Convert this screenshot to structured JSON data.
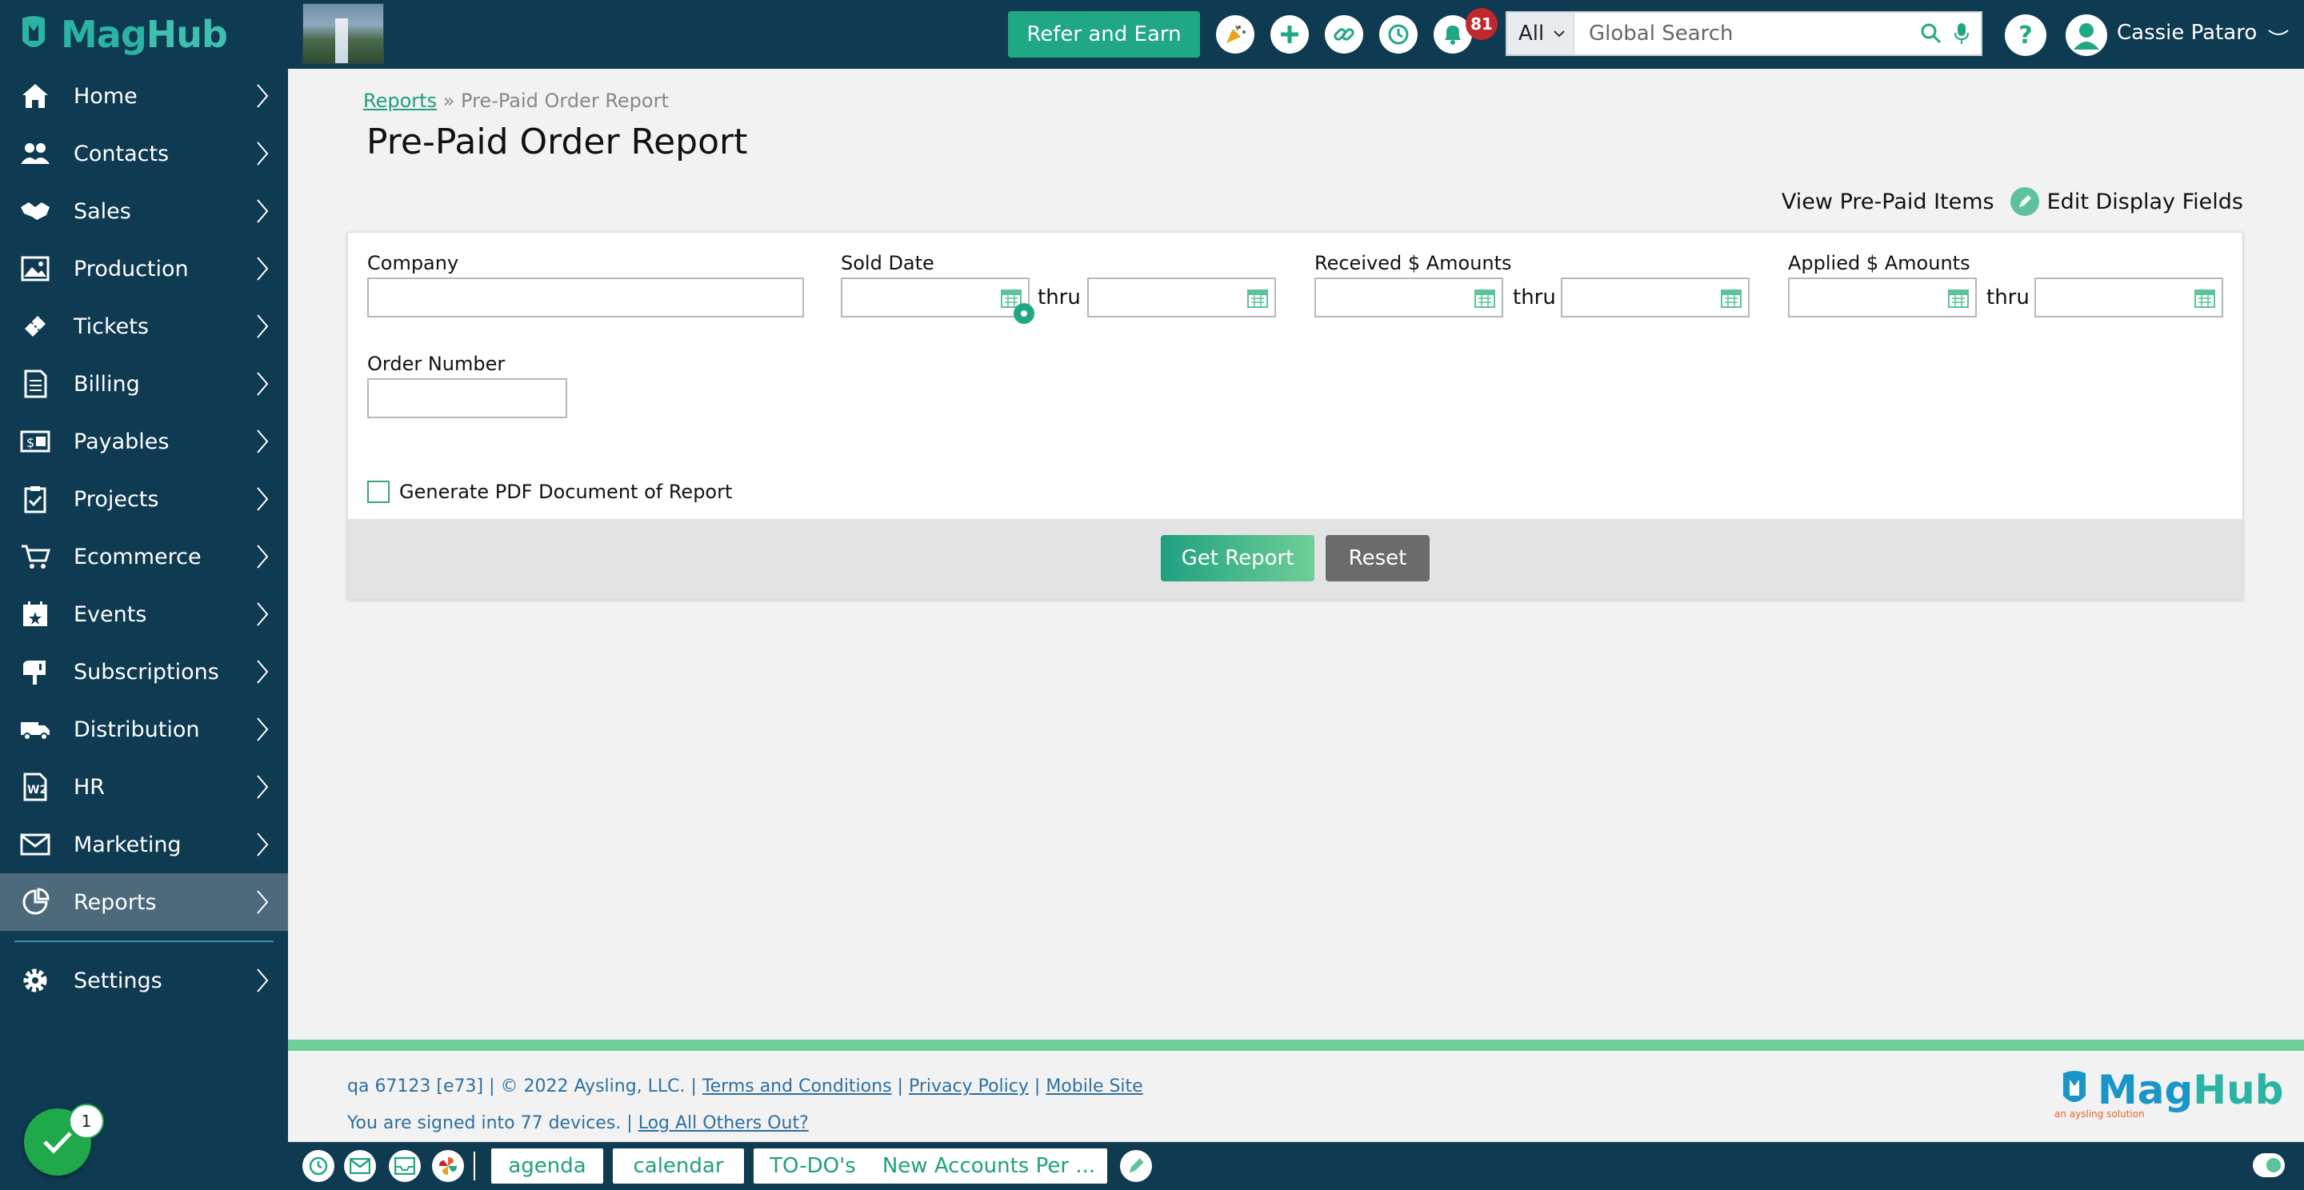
{
  "brand": {
    "name_part1": "Mag",
    "name_part2": "Hub"
  },
  "sidebar": {
    "items": [
      {
        "label": "Home",
        "icon": "home-icon"
      },
      {
        "label": "Contacts",
        "icon": "contacts-icon"
      },
      {
        "label": "Sales",
        "icon": "handshake-icon"
      },
      {
        "label": "Production",
        "icon": "image-icon"
      },
      {
        "label": "Tickets",
        "icon": "ticket-icon"
      },
      {
        "label": "Billing",
        "icon": "invoice-icon"
      },
      {
        "label": "Payables",
        "icon": "payables-icon"
      },
      {
        "label": "Projects",
        "icon": "clipboard-icon"
      },
      {
        "label": "Ecommerce",
        "icon": "cart-icon"
      },
      {
        "label": "Events",
        "icon": "calendar-star-icon"
      },
      {
        "label": "Subscriptions",
        "icon": "mailbox-icon"
      },
      {
        "label": "Distribution",
        "icon": "truck-icon"
      },
      {
        "label": "HR",
        "icon": "w2-icon"
      },
      {
        "label": "Marketing",
        "icon": "envelope-icon"
      },
      {
        "label": "Reports",
        "icon": "reports-icon"
      }
    ],
    "settings": {
      "label": "Settings",
      "icon": "gear-icon"
    },
    "active_index": 14,
    "task_count": "1"
  },
  "topbar": {
    "refer_label": "Refer and Earn",
    "notifications_count": "81",
    "search": {
      "scope": "All",
      "placeholder": "Global Search"
    },
    "help": "?",
    "user_name": "Cassie Pataro"
  },
  "main": {
    "breadcrumb": {
      "parent": "Reports",
      "separator": "»",
      "current": "Pre-Paid Order Report"
    },
    "title": "Pre-Paid Order Report",
    "links": {
      "view_items": "View Pre-Paid Items",
      "edit_fields": "Edit Display Fields"
    },
    "form": {
      "company_label": "Company",
      "sold_date_label": "Sold Date",
      "received_label": "Received $ Amounts",
      "applied_label": "Applied $ Amounts",
      "order_number_label": "Order Number",
      "thru": "thru",
      "pdf_label": "Generate PDF Document of Report",
      "get_report": "Get Report",
      "reset": "Reset"
    }
  },
  "footer": {
    "version_text": "qa 67123 [e73] | © 2022 Aysling, LLC. |",
    "terms": "Terms and Conditions",
    "privacy": "Privacy Policy",
    "mobile": "Mobile Site",
    "sep": "|",
    "signed_in": "You are signed into 77 devices. |",
    "log_out_others": "Log All Others Out?",
    "logo_part1": "Mag",
    "logo_part2": "Hub",
    "logo_sub": "an aysling solution"
  },
  "bottombar": {
    "tabs": [
      "agenda",
      "calendar",
      "TO-DO's",
      "New Accounts Per ..."
    ]
  },
  "colors": {
    "navy": "#0e3a52",
    "accent": "#20a883",
    "active_nav": "#4d6a7d"
  }
}
